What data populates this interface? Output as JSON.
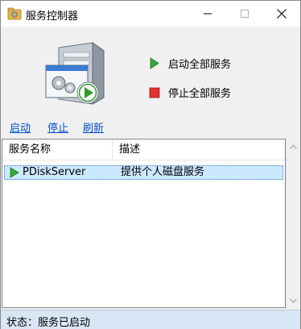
{
  "window": {
    "title": "服务控制器",
    "icon": "gear-folder-icon",
    "controls": [
      "minimize-icon",
      "maximize-icon",
      "close-icon"
    ]
  },
  "actions": {
    "start_all": "启动全部服务",
    "stop_all": "停止全部服务"
  },
  "links": {
    "start": "启动",
    "stop": "停止",
    "refresh": "刷新"
  },
  "list": {
    "columns": [
      "服务名称",
      "描述"
    ],
    "rows": [
      {
        "name": "PDiskServer",
        "description": "提供个人磁盘服务",
        "status_icon": "running-play-icon",
        "selected": true
      }
    ]
  },
  "status": {
    "text": "状态：服务已启动"
  },
  "colors": {
    "link": "#0050c8",
    "play_green": "#38a838",
    "stop_red": "#e03030",
    "status_bar": "#d9e6f5",
    "selection": "#cce8ff"
  }
}
